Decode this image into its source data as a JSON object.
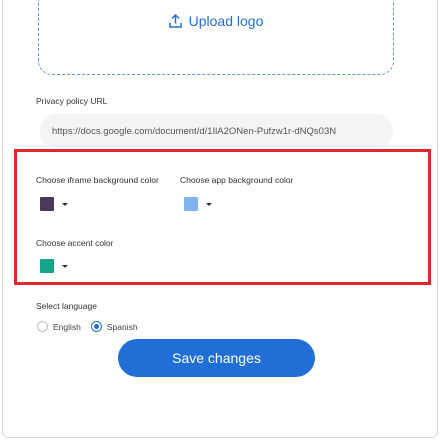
{
  "upload": {
    "label": "Upload logo",
    "icon": "upload-icon"
  },
  "privacy": {
    "label": "Privacy policy URL",
    "value": "https://docs.google.com/document/d/1IlA2ONen-Pufzw1r-dNQs03N"
  },
  "colors": {
    "iframe_bg": {
      "label": "Choose iframe background color",
      "color": "#4a3b5c"
    },
    "app_bg": {
      "label": "Choose app background color",
      "color": "#7fb2ef"
    },
    "accent": {
      "label": "Choose accent color",
      "color": "#17a589"
    }
  },
  "language": {
    "label": "Select language",
    "options": [
      {
        "label": "English",
        "selected": false
      },
      {
        "label": "Spanish",
        "selected": true
      }
    ]
  },
  "save_label": "Save changes",
  "theme": {
    "primary": "#1f6fd6",
    "highlight": "#e3262b"
  }
}
